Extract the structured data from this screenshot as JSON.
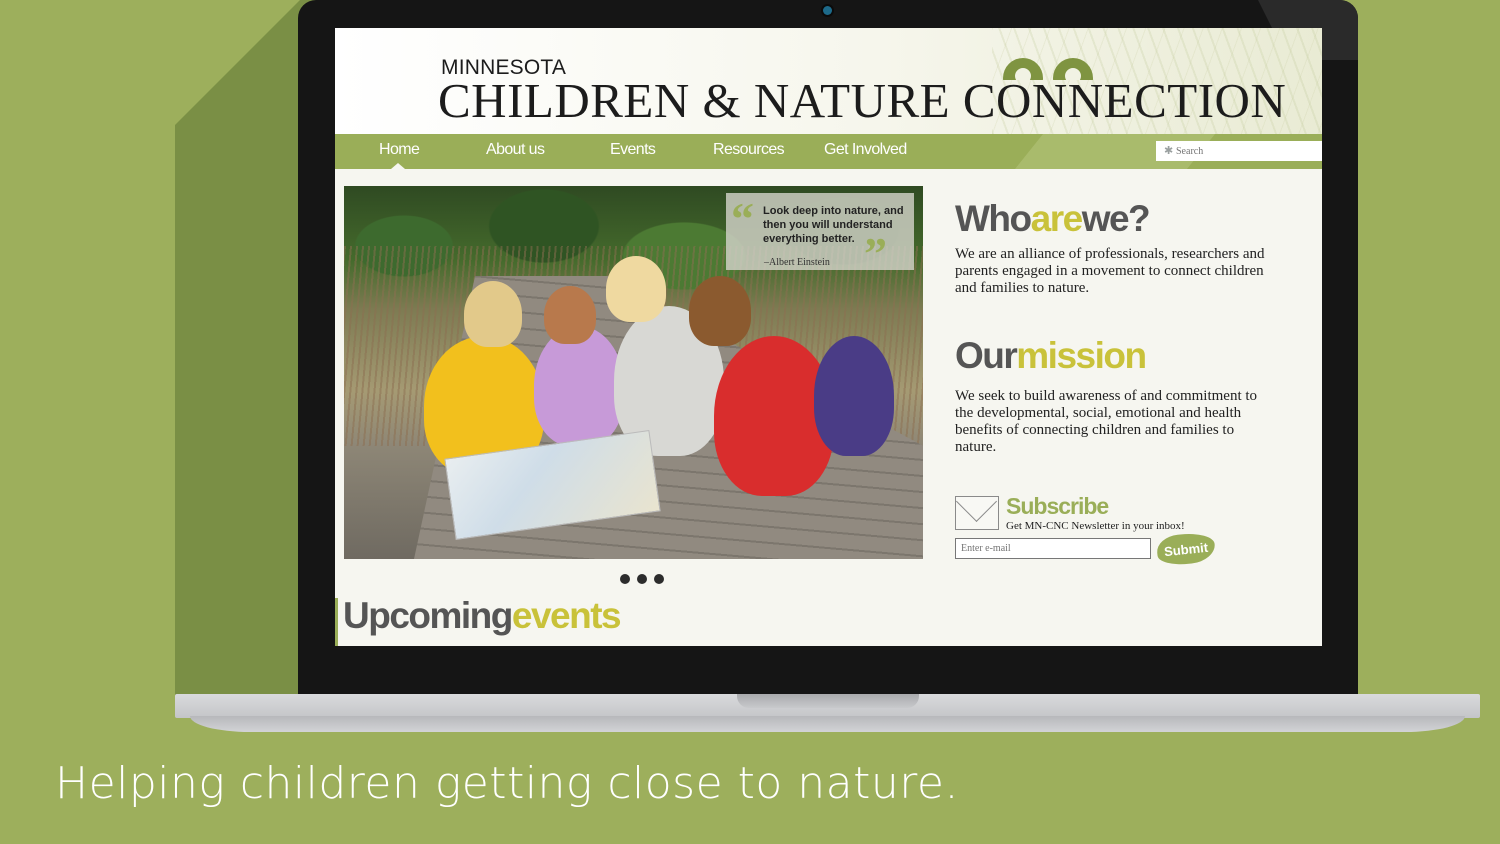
{
  "site": {
    "kicker": "MINNESOTA",
    "title": "CHILDREN & NATURE CONNECTION"
  },
  "nav": {
    "items": [
      "Home",
      "About us",
      "Events",
      "Resources",
      "Get Involved"
    ],
    "active": "Home",
    "search_placeholder": "Search"
  },
  "hero": {
    "quote": "Look deep into nature, and then you will understand everything better.",
    "author": "–Albert Einstein",
    "slides": 3
  },
  "who": {
    "heading_a": "Who",
    "heading_b": "are",
    "heading_c": "we?",
    "text": "We are an alliance of professionals, researchers and parents engaged in a movement to connect children and families to nature."
  },
  "mission": {
    "heading_a": "Our",
    "heading_b": "mission",
    "text": "We seek to build awareness of and commitment to the developmental, social, emotional and health benefits of connecting children and families to nature."
  },
  "subscribe": {
    "title": "Subscribe",
    "note": "Get MN-CNC Newsletter in your inbox!",
    "email_placeholder": "Enter e-mail",
    "submit_label": "Submit"
  },
  "upcoming": {
    "heading_a": "Upcoming",
    "heading_b": "events"
  },
  "caption": "Helping children getting close to nature.",
  "colors": {
    "background": "#9daf5c",
    "nav": "#9aae58",
    "accent": "#c9c23a"
  }
}
